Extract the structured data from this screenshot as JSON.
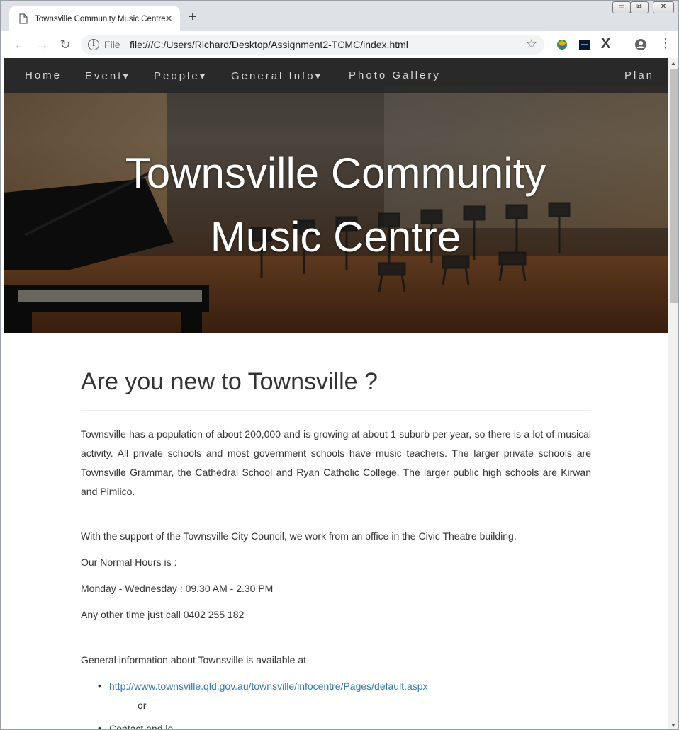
{
  "browser": {
    "tab_title": "Townsville Community Music Centre",
    "tab_close": "✕",
    "new_tab": "+",
    "window_controls": {
      "minimize": "▭",
      "restore": "⧉",
      "close": "✕"
    },
    "back": "←",
    "forward": "→",
    "reload": "↻",
    "omnibox": {
      "info_glyph": "i",
      "scheme_label": "File",
      "url": "file:///C:/Users/Richard/Desktop/Assignment2-TCMC/index.html",
      "star": "☆"
    },
    "extension_icons": [
      "extension-globe-icon",
      "extension-dark-icon",
      "extension-x-icon",
      "profile-icon",
      "menu-icon"
    ],
    "x_glyph": "X",
    "menu_glyph": "⋮"
  },
  "nav": {
    "home": "Home",
    "event": "Event▾",
    "people": "People▾",
    "general_info": "General Info▾",
    "photo_gallery": "Photo Gallery",
    "plan": "Plan"
  },
  "hero": {
    "title_line1": "Townsville Community",
    "title_line2": "Music Centre"
  },
  "main": {
    "heading": "Are you new to Townsville ?",
    "intro": "Townsville has a population of about 200,000 and is growing at about 1 suburb per year, so there is a lot of musical activity. All private schools and most government schools have music teachers. The larger private schools are Townsville Grammar, the Cathedral School and Ryan Catholic College. The larger public high schools are Kirwan and Pimlico.",
    "support": "With the support of the Townsville City Council, we work from an office in the Civic Theatre building.",
    "hours_label": "Our Normal Hours is :",
    "hours": "Monday - Wednesday : 09.30 AM - 2.30 PM",
    "call": "Any other time just call 0402 255 182",
    "general_info": "General information about Townsville is available at",
    "link1": "http://www.townsville.qld.gov.au/townsville/infocentre/Pages/default.aspx",
    "or": "or",
    "partial": "Contact and le..."
  },
  "colors": {
    "link": "#337ab7",
    "navbar": "#282828",
    "text": "#333333"
  }
}
